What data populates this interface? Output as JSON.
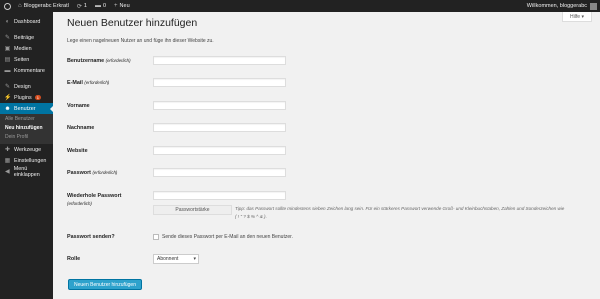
{
  "adminbar": {
    "site_name": "Bloggerabc Erkratl",
    "updates_count": "1",
    "comments_count": "0",
    "new_label": "Neu",
    "greeting": "Willkommen, bloggerabc"
  },
  "sidebar": {
    "items": [
      {
        "label": "Dashboard",
        "icon": "dashboard-icon",
        "glyph": "◐"
      },
      {
        "label": "Beiträge",
        "icon": "pin-icon",
        "glyph": "✎"
      },
      {
        "label": "Medien",
        "icon": "media-icon",
        "glyph": "▣"
      },
      {
        "label": "Seiten",
        "icon": "pages-icon",
        "glyph": "▤"
      },
      {
        "label": "Kommentare",
        "icon": "comments-icon",
        "glyph": "▬"
      },
      {
        "label": "Design",
        "icon": "brush-icon",
        "glyph": "✎"
      },
      {
        "label": "Plugins",
        "icon": "plugin-icon",
        "glyph": "⚡",
        "badge": "1"
      },
      {
        "label": "Benutzer",
        "icon": "users-icon",
        "glyph": "☻"
      },
      {
        "label": "Werkzeuge",
        "icon": "tools-icon",
        "glyph": "✚"
      },
      {
        "label": "Einstellungen",
        "icon": "settings-icon",
        "glyph": "▦"
      },
      {
        "label": "Menü einklappen",
        "icon": "collapse-icon",
        "glyph": "◀"
      }
    ],
    "submenu": [
      "Alle Benutzer",
      "Neu hinzufügen",
      "Dein Profil"
    ]
  },
  "help_tab": "Hilfe ▾",
  "main": {
    "title": "Neuen Benutzer hinzufügen",
    "description": "Lege einen nagelneuen Nutzer an und füge ihn dieser Website zu.",
    "fields": {
      "username": {
        "label": "Benutzername",
        "req": "(erforderlich)"
      },
      "email": {
        "label": "E-Mail",
        "req": "(erforderlich)"
      },
      "firstname": {
        "label": "Vorname"
      },
      "lastname": {
        "label": "Nachname"
      },
      "website": {
        "label": "Website"
      },
      "password": {
        "label": "Passwort",
        "req": "(erforderlich)"
      },
      "password2": {
        "label": "Wiederhole Passwort",
        "req": "(erforderlich)"
      }
    },
    "strength_label": "Passwortstärke",
    "password_hint": "Tipp: das Passwort sollte mindestens sieben Zeichen lang sein. Für ein stärkeres Passwort verwende Groß- und Kleinbuchstaben, Zahlen und Sonderzeichen wie ( ! \" ? $ % ^ & ).",
    "send_password_label": "Passwort senden?",
    "send_password_text": "Sende dieses Passwort per E-Mail an den neuen Benutzer.",
    "role_label": "Rolle",
    "role_value": "Abonnent",
    "submit_label": "Neuen Benutzer hinzufügen"
  }
}
